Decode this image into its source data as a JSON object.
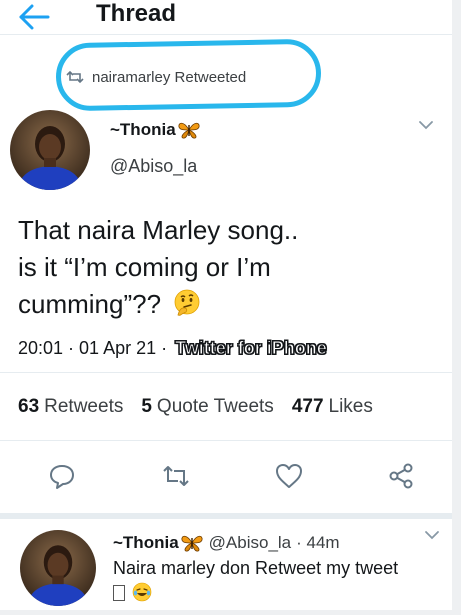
{
  "header": {
    "title": "Thread"
  },
  "retweet_context": {
    "text": "nairamarley Retweeted"
  },
  "tweet": {
    "display_name": "~Thonia",
    "handle": "@Abiso_la",
    "text_line1": "That naira Marley song..",
    "text_line2": "is it “I’m coming or I’m",
    "text_line3": "cumming”??",
    "time": "20:01",
    "date": "01 Apr 21",
    "separator": "·",
    "source": "Twitter for iPhone"
  },
  "stats": {
    "retweets_count": "63",
    "retweets_label": "Retweets",
    "quote_count": "5",
    "quote_label": "Quote Tweets",
    "likes_count": "477",
    "likes_label": "Likes"
  },
  "reply": {
    "display_name": "~Thonia",
    "handle": "@Abiso_la",
    "time": "· 44m",
    "text": "Naira marley don Retweet my tweet",
    "text_line2": "\u0000"
  },
  "icons": {
    "back": "arrow-left-icon",
    "retweet_small": "retweet-icon",
    "caret": "chevron-down-icon",
    "reply": "comment-icon",
    "retweet": "retweet-icon",
    "like": "heart-icon",
    "share": "share-icon",
    "emoji_think": "thinking-face-emoji",
    "emoji_laugh": "laughing-face-emoji",
    "butterfly": "butterfly-emoji"
  },
  "colors": {
    "accent": "#1da1f2",
    "highlight_ring": "#29b7ec",
    "text_primary": "#14171a",
    "text_secondary": "#3c4043"
  }
}
